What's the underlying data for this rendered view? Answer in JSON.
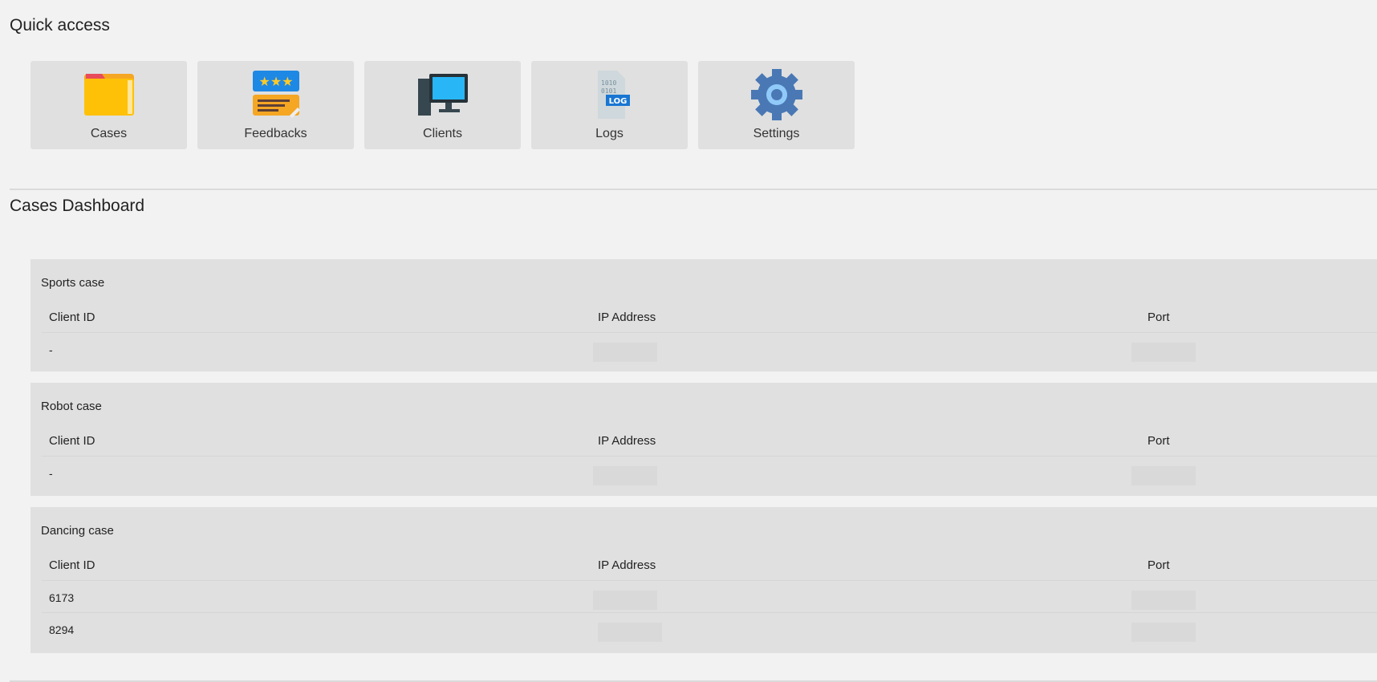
{
  "quick_access": {
    "title": "Quick access",
    "tiles": [
      {
        "label": "Cases",
        "icon": "folder-icon"
      },
      {
        "label": "Feedbacks",
        "icon": "feedback-icon"
      },
      {
        "label": "Clients",
        "icon": "computer-icon"
      },
      {
        "label": "Logs",
        "icon": "log-file-icon"
      },
      {
        "label": "Settings",
        "icon": "gear-icon"
      }
    ]
  },
  "dashboard": {
    "title": "Cases Dashboard",
    "columns": {
      "client_id": "Client ID",
      "ip": "IP Address",
      "port": "Port"
    },
    "cases": [
      {
        "name": "Sports case",
        "rows": [
          {
            "client_id": "-"
          }
        ]
      },
      {
        "name": "Robot case",
        "rows": [
          {
            "client_id": "-"
          }
        ]
      },
      {
        "name": "Dancing case",
        "rows": [
          {
            "client_id": "6173"
          },
          {
            "client_id": "8294"
          }
        ]
      }
    ]
  }
}
